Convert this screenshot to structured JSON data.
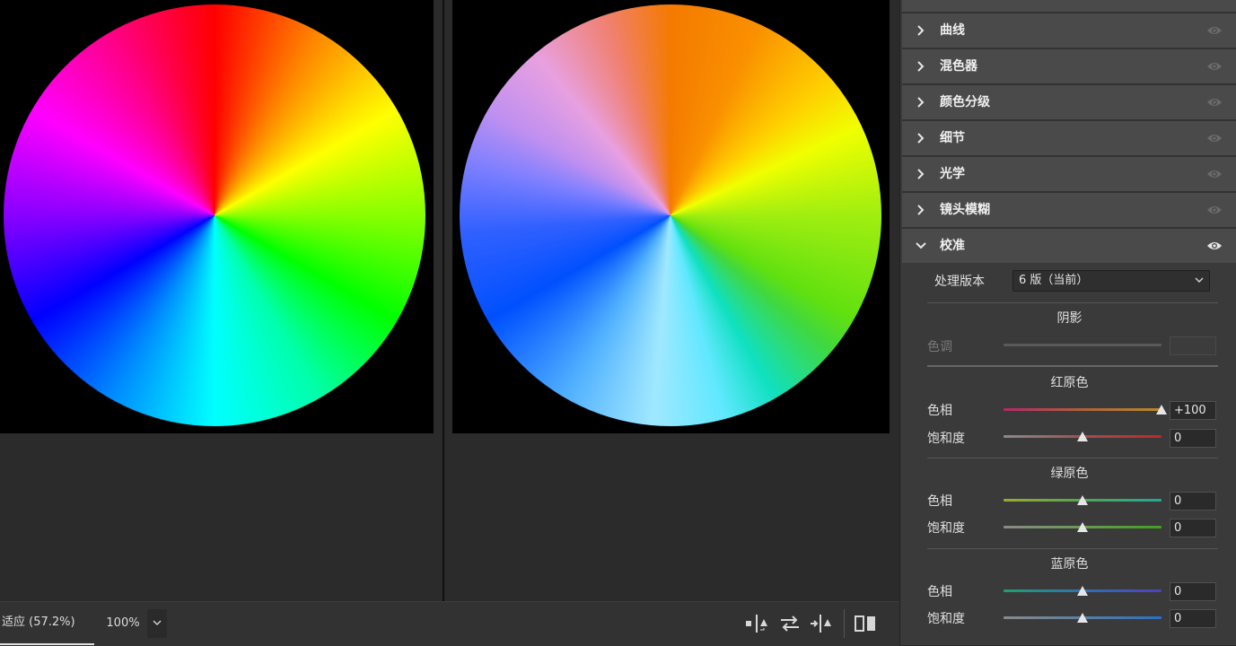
{
  "preview": {
    "before_label": "",
    "after_label": ""
  },
  "bottombar": {
    "zoom_fit": "适应 (57.2%)",
    "zoom_100": "100%",
    "icons": [
      "split-before-after-icon",
      "swap-icon",
      "copy-settings-icon",
      "compare-view-icon"
    ]
  },
  "panel": {
    "sections": [
      {
        "title": "曲线",
        "expanded": false
      },
      {
        "title": "混色器",
        "expanded": false
      },
      {
        "title": "颜色分级",
        "expanded": false
      },
      {
        "title": "细节",
        "expanded": false
      },
      {
        "title": "光学",
        "expanded": false
      },
      {
        "title": "镜头模糊",
        "expanded": false
      },
      {
        "title": "校准",
        "expanded": true
      }
    ],
    "calibration": {
      "process_label": "处理版本",
      "process_value": "6 版（当前）",
      "shadows": {
        "title": "阴影",
        "tint_label": "色调",
        "tint_value": ""
      },
      "red": {
        "title": "红原色",
        "hue_label": "色相",
        "hue_value": "+100",
        "hue_level": 100,
        "sat_label": "饱和度",
        "sat_value": "0",
        "sat_level": 0
      },
      "green": {
        "title": "绿原色",
        "hue_label": "色相",
        "hue_value": "0",
        "hue_level": 0,
        "sat_label": "饱和度",
        "sat_value": "0",
        "sat_level": 0
      },
      "blue": {
        "title": "蓝原色",
        "hue_label": "色相",
        "hue_value": "0",
        "hue_level": 0,
        "sat_label": "饱和度",
        "sat_value": "0",
        "sat_level": 0
      }
    }
  }
}
